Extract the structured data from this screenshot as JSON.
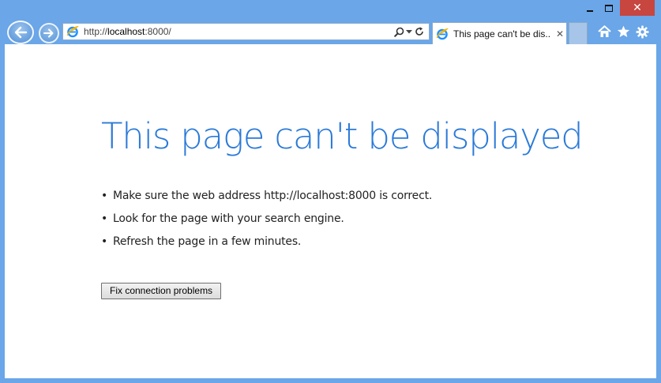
{
  "window": {
    "minimize_icon": "minimize-icon",
    "maximize_icon": "maximize-icon",
    "close_icon": "close-icon",
    "close_color": "#c7463f",
    "frame_color": "#6aa6e8"
  },
  "nav": {
    "back_icon": "back-arrow-icon",
    "forward_icon": "forward-arrow-icon"
  },
  "address": {
    "url_prefix": "http://",
    "url_host": "localhost",
    "url_suffix": ":8000/"
  },
  "tab": {
    "title": "This page can't be dis...",
    "close_label": "✕"
  },
  "toolbar": {
    "home_icon": "home-icon",
    "favorites_icon": "star-icon",
    "tools_icon": "gear-icon"
  },
  "page": {
    "title": "This page can't be displayed",
    "title_color": "#2b7ad8",
    "bullet": "•",
    "tips": [
      "Make sure the web address http://localhost:8000 is correct.",
      "Look for the page with your search engine.",
      "Refresh the page in a few minutes."
    ],
    "fix_button_label": "Fix connection problems"
  }
}
